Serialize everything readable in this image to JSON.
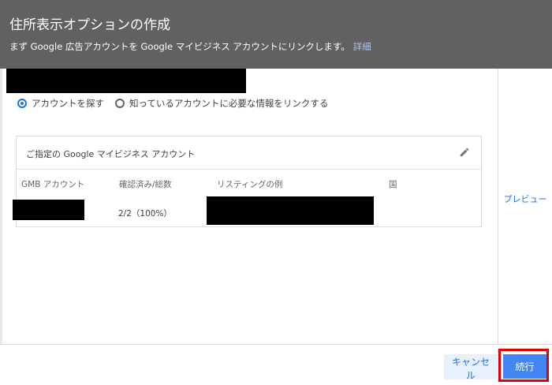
{
  "header": {
    "title": "住所表示オプションの作成",
    "subtitle": "まず Google 広告アカウントを Google マイビジネス アカウントにリンクします。",
    "learn_more": "詳細"
  },
  "radio_options": [
    {
      "label": "アカウントを探す",
      "checked": true
    },
    {
      "label": "知っているアカウントに必要な情報をリンクする",
      "checked": false
    }
  ],
  "card": {
    "title": "ご指定の Google マイビジネス アカウント",
    "columns": [
      "GMB アカウント",
      "確認済み/総数",
      "リスティングの例",
      "国"
    ],
    "row": {
      "verified": "2/2（100%）"
    }
  },
  "preview_label": "プレビュー",
  "footer": {
    "cancel_label": "キャンセル",
    "continue_label": "続行"
  },
  "colors": {
    "header_bg": "#616161",
    "accent": "#1a73e8",
    "primary_button": "#4285f4",
    "highlight_border": "#e00000"
  }
}
